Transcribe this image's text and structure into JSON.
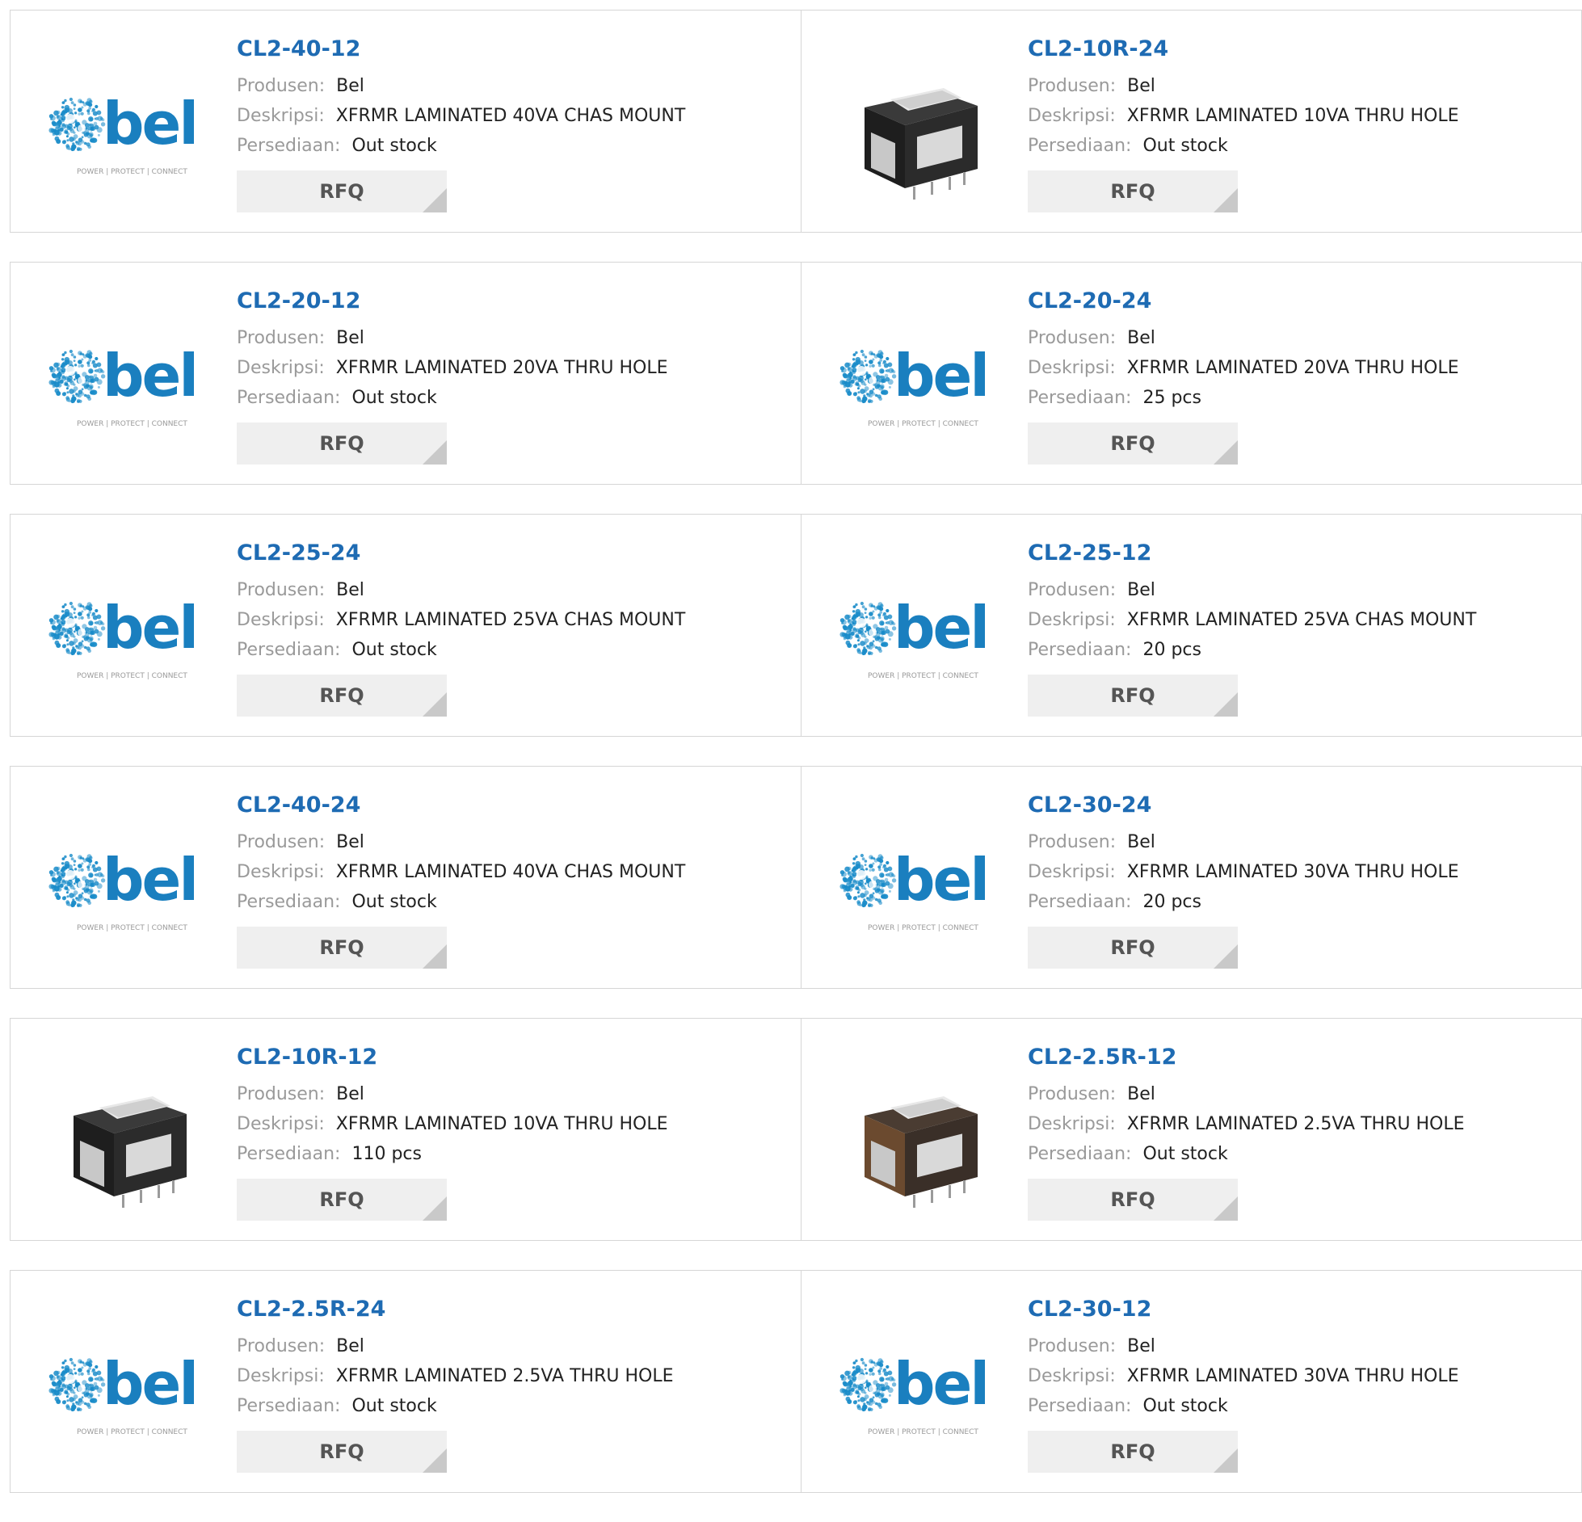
{
  "labels": {
    "manufacturer": "Produsen:",
    "description": "Deskripsi:",
    "stock": "Persediaan:",
    "rfq": "RFQ"
  },
  "colors": {
    "part_link": "#1e6bb3",
    "bel_logo": "#1a7fbf",
    "rfq_bg": "#efefef"
  },
  "logo": {
    "wordmark": "bel",
    "tagline": "POWER | PROTECT | CONNECT"
  },
  "products": [
    {
      "part": "CL2-40-12",
      "manufacturer": "Bel",
      "description": "XFRMR LAMINATED 40VA CHAS MOUNT",
      "stock": "Out stock",
      "image": "bel-logo"
    },
    {
      "part": "CL2-10R-24",
      "manufacturer": "Bel",
      "description": "XFRMR LAMINATED 10VA THRU HOLE",
      "stock": "Out stock",
      "image": "transformer-photo"
    },
    {
      "part": "CL2-20-12",
      "manufacturer": "Bel",
      "description": "XFRMR LAMINATED 20VA THRU HOLE",
      "stock": "Out stock",
      "image": "bel-logo"
    },
    {
      "part": "CL2-20-24",
      "manufacturer": "Bel",
      "description": "XFRMR LAMINATED 20VA THRU HOLE",
      "stock": "25 pcs",
      "image": "bel-logo"
    },
    {
      "part": "CL2-25-24",
      "manufacturer": "Bel",
      "description": "XFRMR LAMINATED 25VA CHAS MOUNT",
      "stock": "Out stock",
      "image": "bel-logo"
    },
    {
      "part": "CL2-25-12",
      "manufacturer": "Bel",
      "description": "XFRMR LAMINATED 25VA CHAS MOUNT",
      "stock": "20 pcs",
      "image": "bel-logo"
    },
    {
      "part": "CL2-40-24",
      "manufacturer": "Bel",
      "description": "XFRMR LAMINATED 40VA CHAS MOUNT",
      "stock": "Out stock",
      "image": "bel-logo"
    },
    {
      "part": "CL2-30-24",
      "manufacturer": "Bel",
      "description": "XFRMR LAMINATED 30VA THRU HOLE",
      "stock": "20 pcs",
      "image": "bel-logo"
    },
    {
      "part": "CL2-10R-12",
      "manufacturer": "Bel",
      "description": "XFRMR LAMINATED 10VA THRU HOLE",
      "stock": "110 pcs",
      "image": "transformer-photo"
    },
    {
      "part": "CL2-2.5R-12",
      "manufacturer": "Bel",
      "description": "XFRMR LAMINATED 2.5VA THRU HOLE",
      "stock": "Out stock",
      "image": "transformer-photo-brown"
    },
    {
      "part": "CL2-2.5R-24",
      "manufacturer": "Bel",
      "description": "XFRMR LAMINATED 2.5VA THRU HOLE",
      "stock": "Out stock",
      "image": "bel-logo"
    },
    {
      "part": "CL2-30-12",
      "manufacturer": "Bel",
      "description": "XFRMR LAMINATED 30VA THRU HOLE",
      "stock": "Out stock",
      "image": "bel-logo"
    }
  ]
}
